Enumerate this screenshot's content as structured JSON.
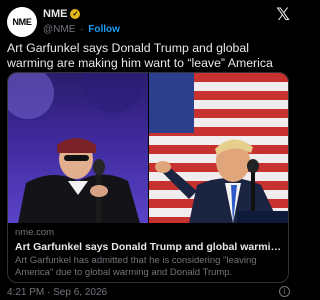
{
  "account": {
    "avatar_text": "NME",
    "name": "NME",
    "handle": "@NME",
    "separator": "·",
    "follow_label": "Follow"
  },
  "tweet": {
    "text": "Art Garfunkel says Donald Trump and global warming are making him want to “leave” America"
  },
  "card": {
    "domain": "nme.com",
    "title": "Art Garfunkel says Donald Trump and global warming are making him ...",
    "description": "Art Garfunkel has admitted that he is considering \"leaving America\" due to global warming and Donald Trump."
  },
  "footer": {
    "timestamp": "4:21 PM · Sep 6, 2026"
  },
  "colors": {
    "accent": "#1d9bf0",
    "verified": "#e2b719",
    "background": "#000000"
  },
  "icons": {
    "logo": "x-logo-icon",
    "verified": "verified-badge-icon",
    "info": "info-icon"
  }
}
